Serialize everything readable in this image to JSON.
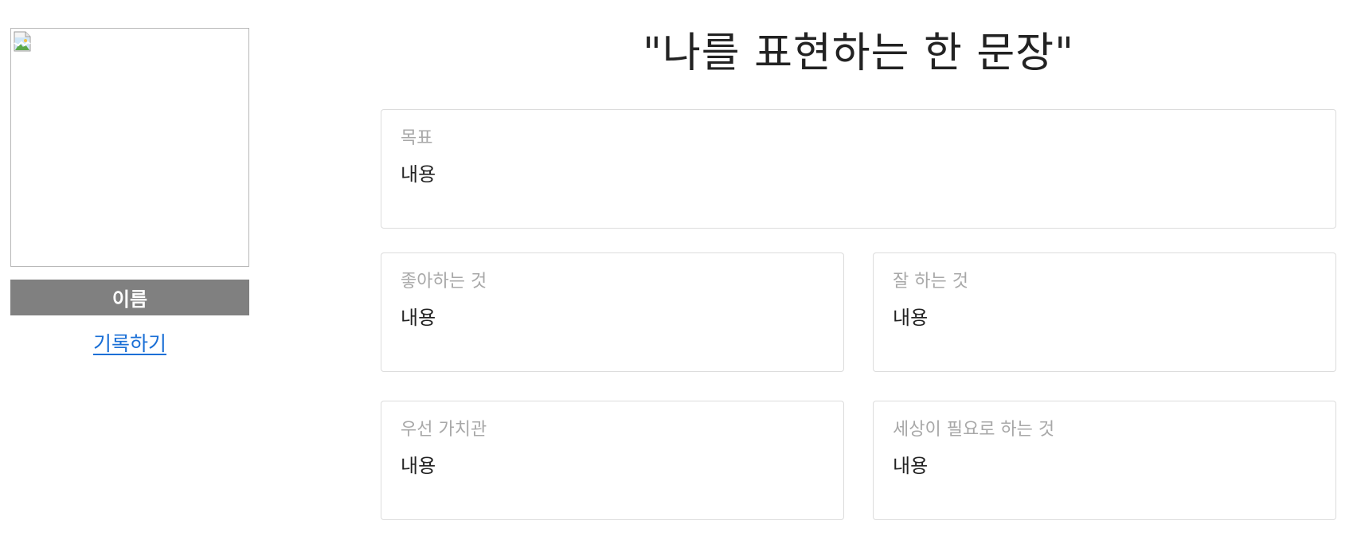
{
  "profile": {
    "name_label": "이름",
    "record_link_label": "기록하기",
    "image_icon": "broken-image-icon"
  },
  "headline": "\"나를 표현하는 한 문장\"",
  "cards": {
    "goal": {
      "label": "목표",
      "value": "내용"
    },
    "likes": {
      "label": "좋아하는 것",
      "value": "내용"
    },
    "good_at": {
      "label": "잘 하는 것",
      "value": "내용"
    },
    "priority_values": {
      "label": "우선 가치관",
      "value": "내용"
    },
    "world_needs": {
      "label": "세상이 필요로 하는 것",
      "value": "내용"
    }
  }
}
